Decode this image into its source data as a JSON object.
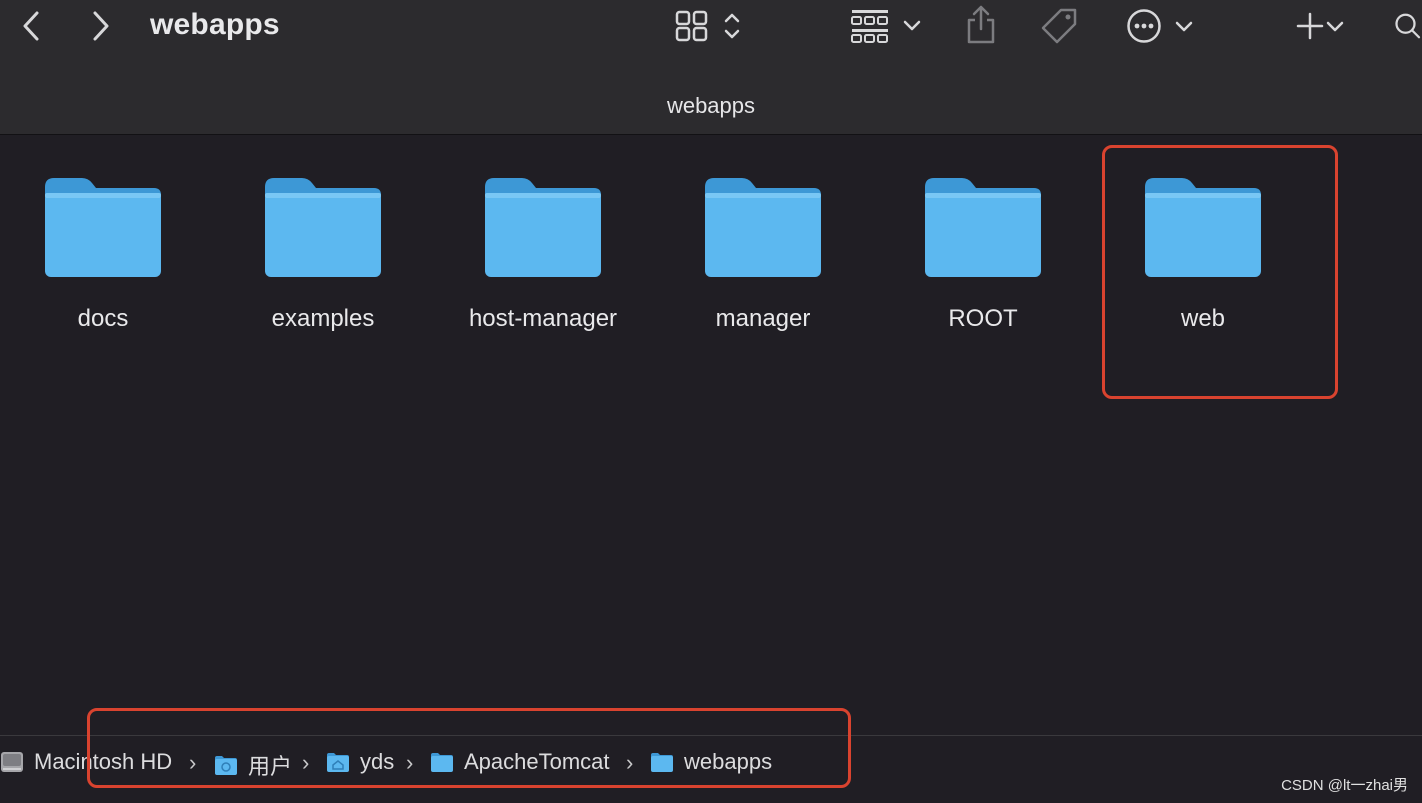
{
  "window": {
    "title": "webapps",
    "path_title": "webapps"
  },
  "toolbar": {
    "back_icon": "chevron-left-icon",
    "forward_icon": "chevron-right-icon",
    "view_icon": "icon-grid-view-icon",
    "group_icon": "group-grid-icon",
    "share_icon": "share-icon",
    "tag_icon": "tag-icon",
    "more_icon": "ellipsis-circle-icon",
    "add_icon": "plus-icon",
    "search_icon": "search-icon"
  },
  "folders": [
    {
      "name": "docs"
    },
    {
      "name": "examples"
    },
    {
      "name": "host-manager"
    },
    {
      "name": "manager"
    },
    {
      "name": "ROOT"
    },
    {
      "name": "web"
    }
  ],
  "breadcrumb": [
    {
      "label": "Macintosh HD",
      "icon": "hard-drive-icon"
    },
    {
      "label": "用户",
      "icon": "folder-icon"
    },
    {
      "label": "yds",
      "icon": "home-folder-icon"
    },
    {
      "label": "ApacheTomcat",
      "icon": "folder-icon"
    },
    {
      "label": "webapps",
      "icon": "folder-icon"
    }
  ],
  "separator": "›",
  "watermark": "CSDN @lt一zhai男",
  "colors": {
    "folder": "#5cb8f0",
    "highlight": "#d9432f",
    "background": "#201e24",
    "toolbar": "#2c2b2e"
  }
}
